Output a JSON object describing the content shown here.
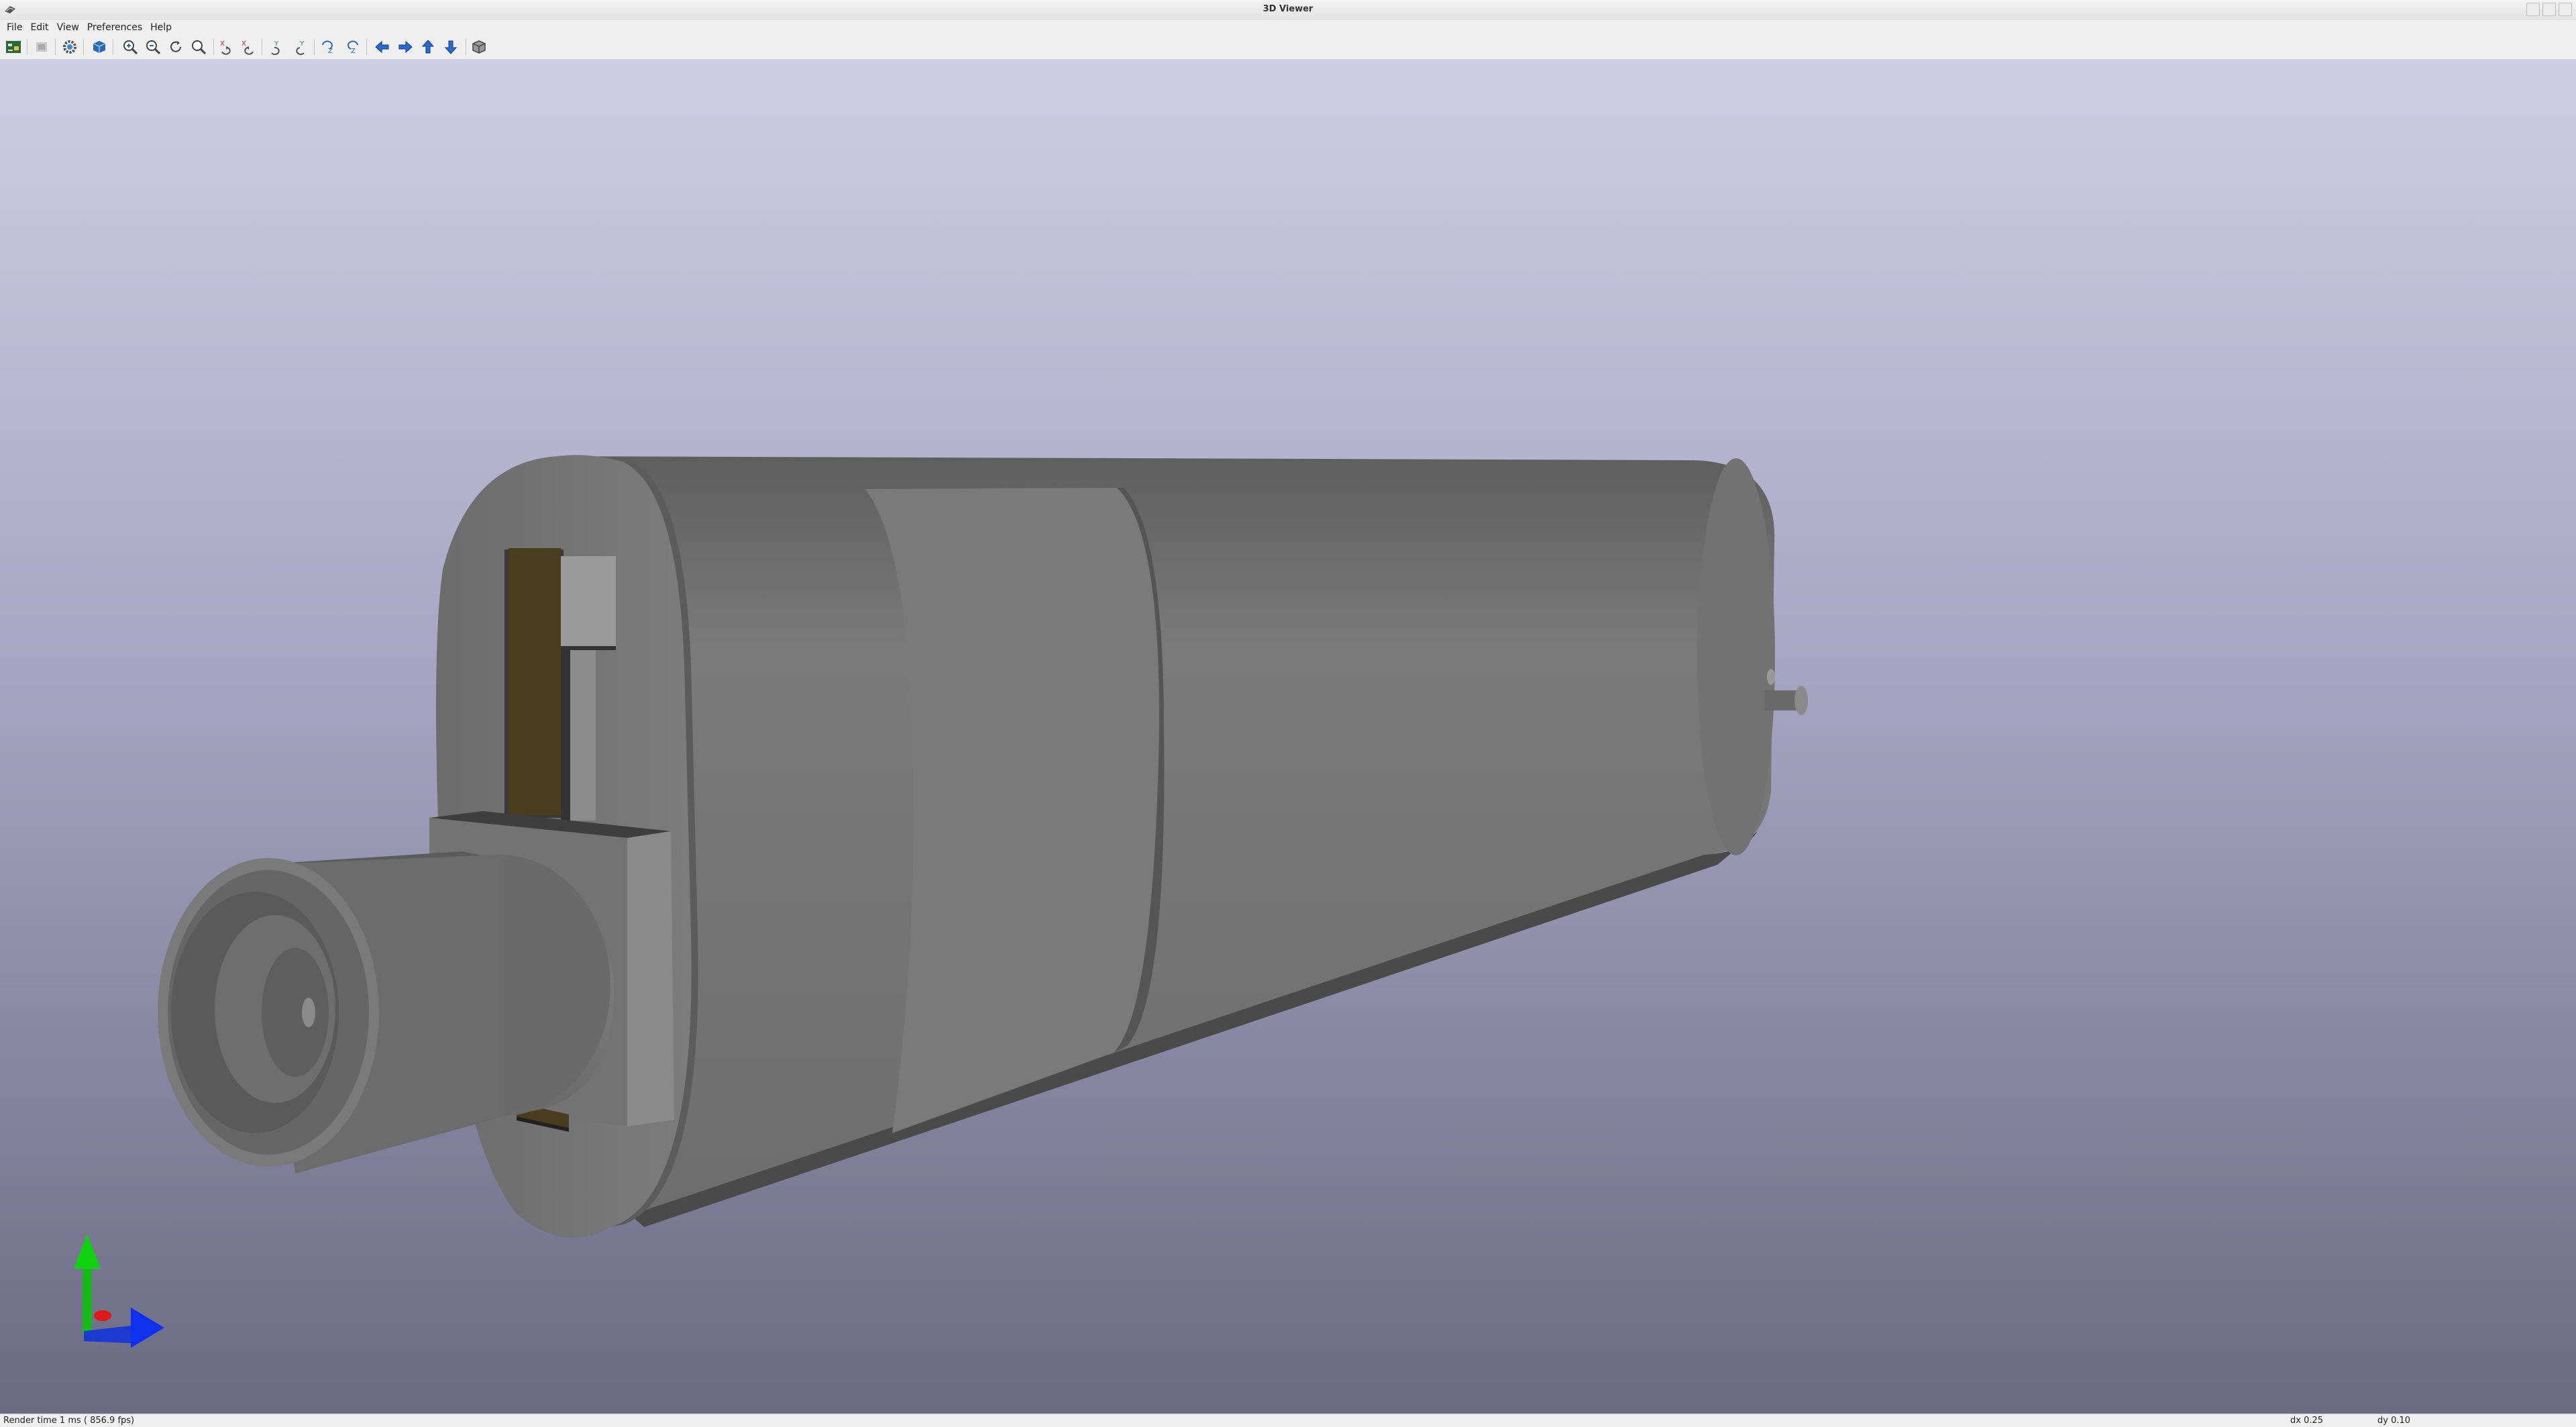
{
  "window": {
    "title": "3D Viewer"
  },
  "menu": [
    "File",
    "Edit",
    "View",
    "Preferences",
    "Help"
  ],
  "toolbar": {
    "buttons": [
      "pcb-editor-icon",
      "refresh-icon",
      "settings-icon",
      "board-3d-icon",
      "zoom-in-icon",
      "zoom-out-icon",
      "zoom-redraw-icon",
      "zoom-fit-icon",
      "rotate-x-cw-icon",
      "rotate-x-ccw-icon",
      "rotate-y-cw-icon",
      "rotate-y-ccw-icon",
      "rotate-z-cw-icon",
      "rotate-z-ccw-icon",
      "move-left-icon",
      "move-right-icon",
      "move-up-icon",
      "move-down-icon",
      "ortho-toggle-icon"
    ]
  },
  "status": {
    "render": "Render time 1 ms ( 856.9 fps)",
    "dx": "dx 0.25",
    "dy": "dy 0.10"
  },
  "colors": {
    "bg_top": "#cdcde6",
    "bg_bottom": "#6a6a84",
    "model_gray": "#747474",
    "pin_brown": "#4a3c1e",
    "axis_x": "#1030e0",
    "axis_y": "#10c010",
    "axis_z": "#e01010"
  }
}
